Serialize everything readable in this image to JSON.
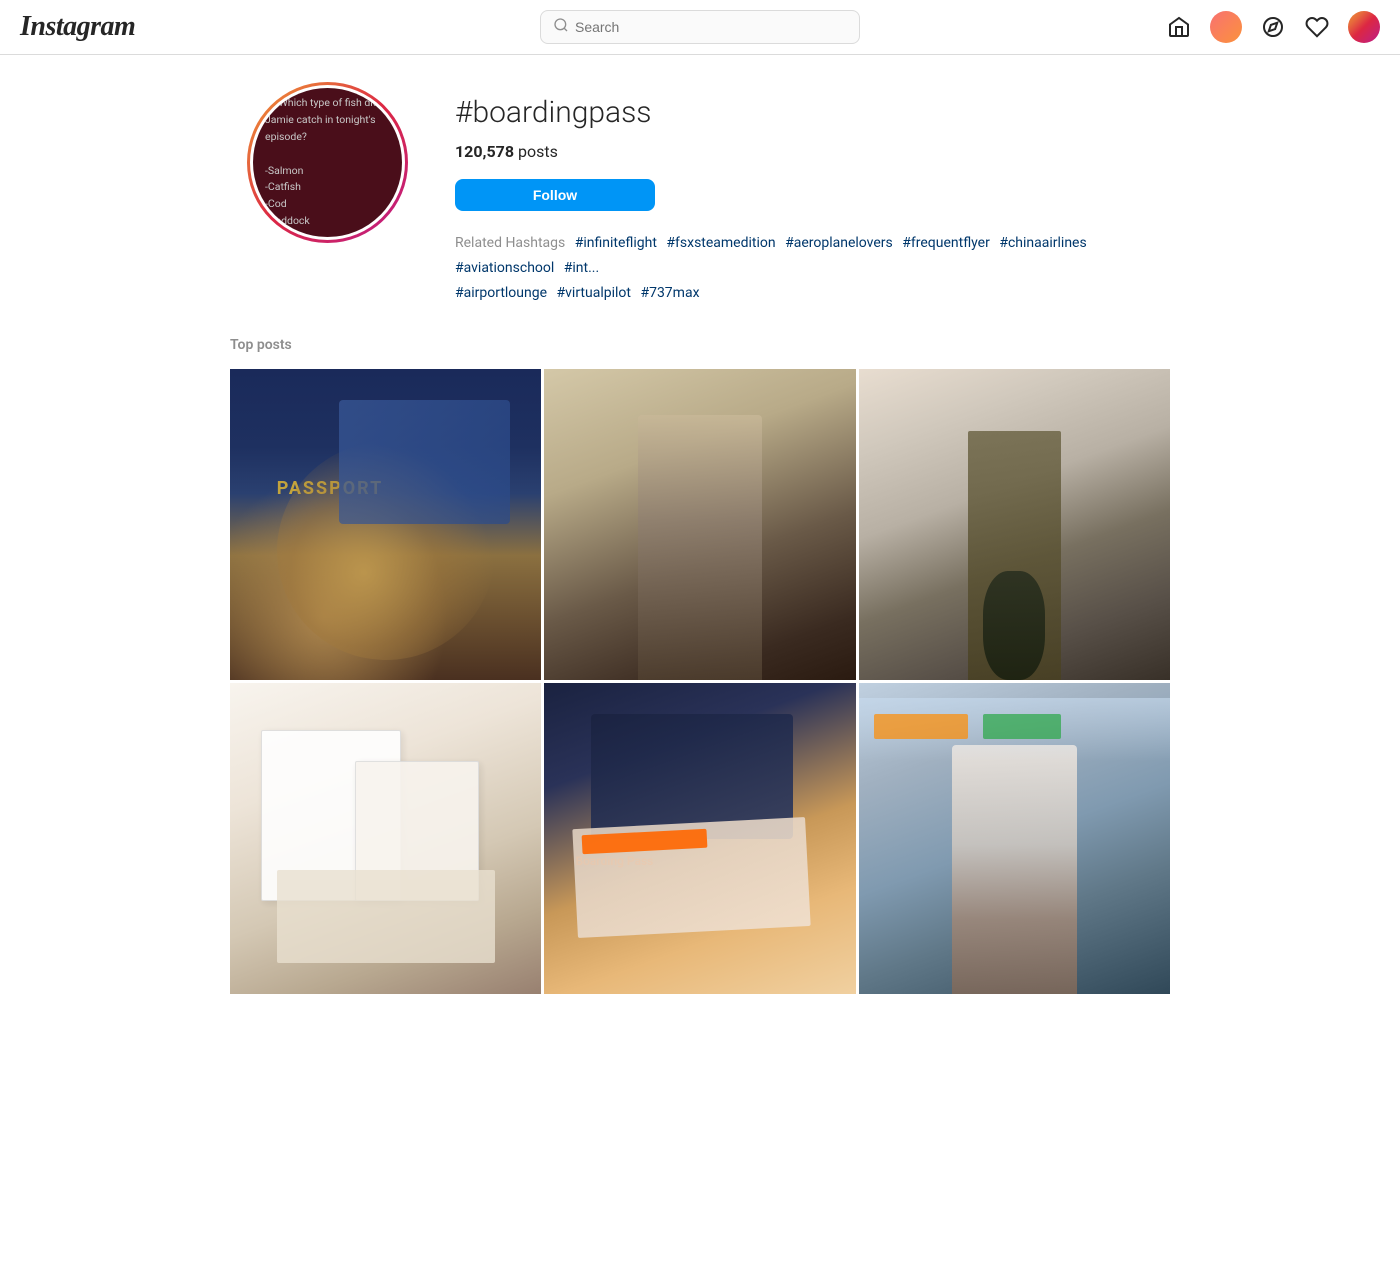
{
  "header": {
    "logo": "Instagram",
    "search": {
      "placeholder": "Search",
      "value": ""
    },
    "nav": {
      "home_label": "Home",
      "explore_label": "Explore",
      "activity_label": "Activity",
      "profile_label": "Profile"
    }
  },
  "profile": {
    "hashtag": "#boardingpass",
    "posts_count": "120,578",
    "posts_label": "posts",
    "follow_label": "Follow",
    "related_label": "Related Hashtags",
    "hashtags": [
      "#infiniteflight",
      "#fsxsteamedition",
      "#aeroplanelovers",
      "#frequentflyer",
      "#chinaairlines",
      "#aviationschool",
      "#int...",
      "#airportlounge",
      "#virtualpilot",
      "#737max"
    ],
    "avatar_lines": [
      "Q) Which type of fish did",
      "Jamie catch in tonight's",
      "episode?",
      "",
      "-Salmon",
      "-Catfish",
      "-Cod",
      "-Haddock"
    ]
  },
  "content": {
    "top_posts_label": "Top posts",
    "posts": [
      {
        "id": 1,
        "type": "passport",
        "alt": "Passport with boarding pass and champagne glass"
      },
      {
        "id": 2,
        "type": "airport-woman",
        "alt": "Woman at airport looking at phone near aircraft"
      },
      {
        "id": 3,
        "type": "military",
        "alt": "Military man with dog in airport corridor"
      },
      {
        "id": 4,
        "type": "wedding",
        "alt": "Wedding invitation with boarding pass design"
      },
      {
        "id": 5,
        "type": "boarding-pass",
        "alt": "Hand holding Belarus passport and boarding pass"
      },
      {
        "id": 6,
        "type": "escalator",
        "alt": "Happy woman on airport escalator"
      }
    ]
  }
}
